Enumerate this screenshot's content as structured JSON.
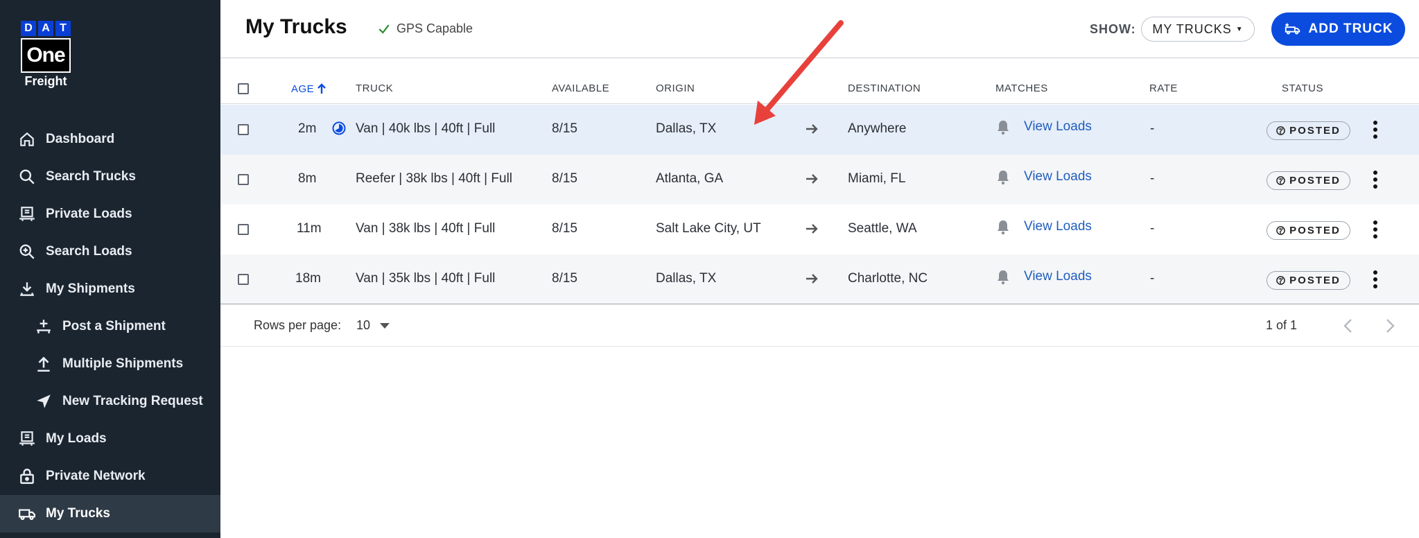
{
  "logo": {
    "letters": [
      "D",
      "A",
      "T"
    ],
    "one": "One",
    "freight": "Freight"
  },
  "sidebar": {
    "items": [
      {
        "label": "Dashboard",
        "icon": "home-icon"
      },
      {
        "label": "Search Trucks",
        "icon": "search-icon"
      },
      {
        "label": "Private Loads",
        "icon": "truck-load-icon"
      },
      {
        "label": "Search Loads",
        "icon": "search-plus-icon"
      },
      {
        "label": "My Shipments",
        "icon": "download-icon"
      },
      {
        "label": "Post a Shipment",
        "icon": "post-icon"
      },
      {
        "label": "Multiple Shipments",
        "icon": "upload-icon"
      },
      {
        "label": "New Tracking Request",
        "icon": "navigation-icon"
      },
      {
        "label": "My Loads",
        "icon": "truck-load-icon"
      },
      {
        "label": "Private Network",
        "icon": "lock-icon"
      },
      {
        "label": "My Trucks",
        "icon": "truck-icon"
      }
    ]
  },
  "header": {
    "title": "My Trucks",
    "gps": "GPS Capable",
    "show_label": "SHOW:",
    "show_value": "MY TRUCKS",
    "add_button": "ADD TRUCK"
  },
  "table": {
    "columns": {
      "age": "AGE",
      "truck": "TRUCK",
      "available": "AVAILABLE",
      "origin": "ORIGIN",
      "destination": "DESTINATION",
      "matches": "MATCHES",
      "rate": "RATE",
      "status": "STATUS"
    },
    "rows": [
      {
        "age": "2m",
        "truck": "Van | 40k lbs | 40ft | Full",
        "available": "8/15",
        "origin": "Dallas, TX",
        "destination": "Anywhere",
        "matches": "View Loads",
        "rate": "-",
        "status": "POSTED"
      },
      {
        "age": "8m",
        "truck": "Reefer | 38k lbs | 40ft | Full",
        "available": "8/15",
        "origin": "Atlanta, GA",
        "destination": "Miami, FL",
        "matches": "View Loads",
        "rate": "-",
        "status": "POSTED"
      },
      {
        "age": "11m",
        "truck": "Van | 38k lbs | 40ft | Full",
        "available": "8/15",
        "origin": "Salt Lake City, UT",
        "destination": "Seattle, WA",
        "matches": "View Loads",
        "rate": "-",
        "status": "POSTED"
      },
      {
        "age": "18m",
        "truck": "Van | 35k lbs | 40ft | Full",
        "available": "8/15",
        "origin": "Dallas, TX",
        "destination": "Charlotte, NC",
        "matches": "View Loads",
        "rate": "-",
        "status": "POSTED"
      }
    ]
  },
  "footer": {
    "rows_per_page_label": "Rows per page:",
    "rows_per_page_value": "10",
    "page_info": "1 of 1"
  },
  "colors": {
    "sidebar_bg": "#1b2530",
    "accent": "#0b4cdf",
    "link": "#1f5dbf",
    "highlight_row": "#e6eef9",
    "annotation": "#e8413c"
  }
}
